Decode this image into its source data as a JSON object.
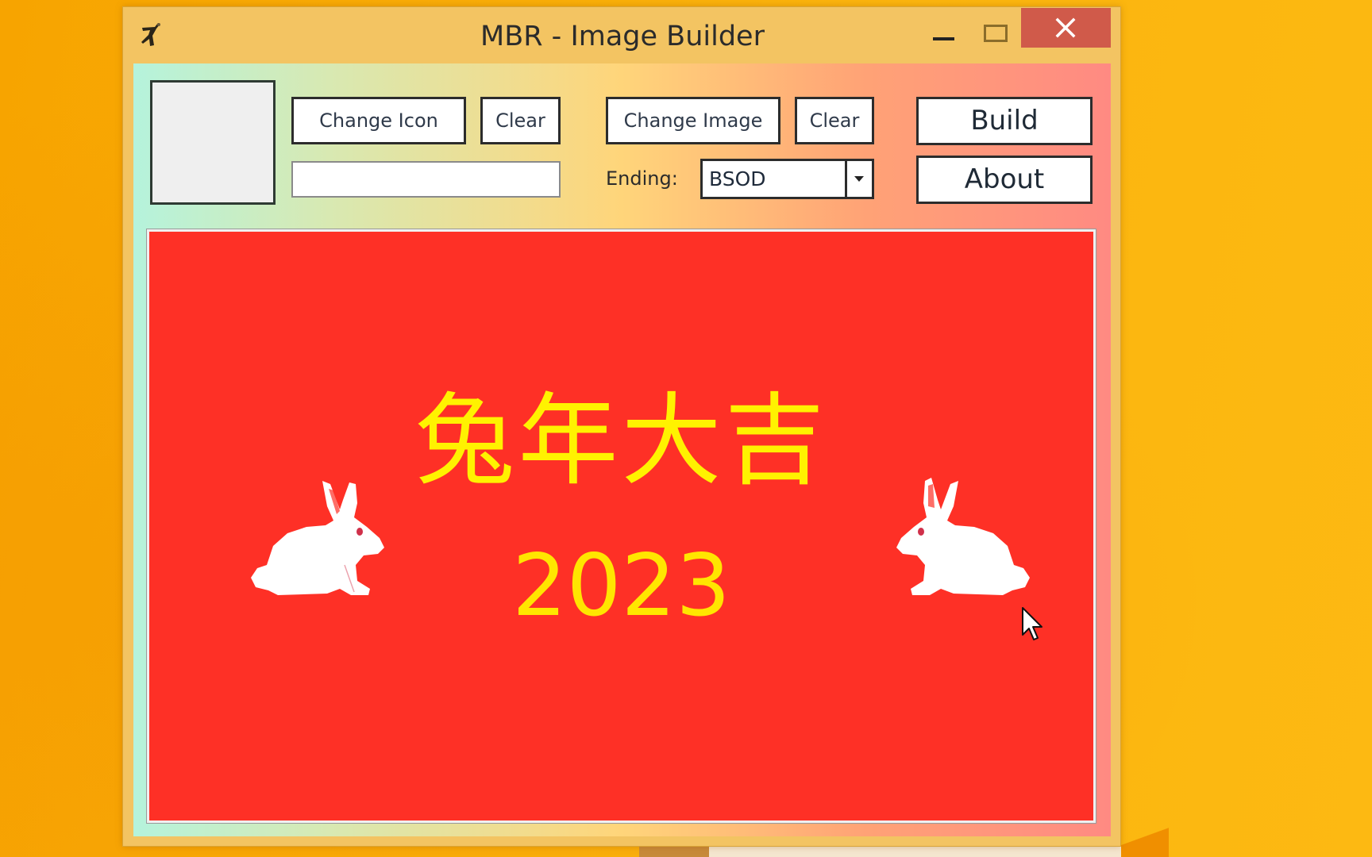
{
  "window": {
    "title": "MBR - Image Builder",
    "app_icon": "app-logo-icon",
    "controls": {
      "minimize": "minimize-icon",
      "maximize": "maximize-icon",
      "close": "close-icon"
    }
  },
  "toolbar": {
    "change_icon_label": "Change Icon",
    "clear_icon_label": "Clear",
    "icon_path_value": "",
    "change_image_label": "Change Image",
    "clear_image_label": "Clear",
    "ending_label": "Ending:",
    "ending_selected": "BSOD",
    "build_label": "Build",
    "about_label": "About"
  },
  "preview": {
    "headline": "兔年大吉",
    "year": "2023",
    "background_color": "#fe3026",
    "text_color": "#ffe600",
    "decorations": [
      "rabbit-icon",
      "rabbit-icon"
    ]
  },
  "colors": {
    "title_bar": "#f3c462",
    "close_button": "#d05a4a",
    "desktop": "#f9ae08"
  }
}
